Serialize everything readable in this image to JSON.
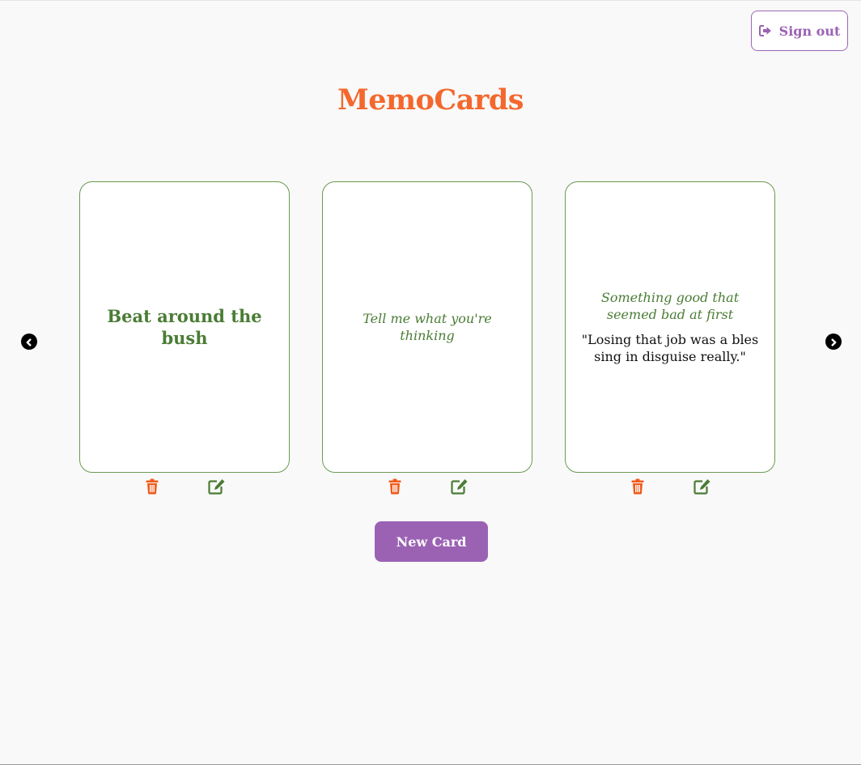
{
  "header": {
    "signout_label": "Sign out",
    "signout_icon": "sign-out-icon"
  },
  "app": {
    "title": "MemoCards"
  },
  "carousel": {
    "prev_icon": "chevron-circle-left-icon",
    "next_icon": "chevron-circle-right-icon",
    "cards": [
      {
        "front": "Beat around the bush"
      },
      {
        "meaning": "Tell me what you're thinking"
      },
      {
        "meaning": "Something good that seemed bad at first",
        "example": "\"Losing that job was a blessing in disguise really.\""
      }
    ],
    "card_actions": {
      "delete_icon": "trash-icon",
      "edit_icon": "edit-icon"
    }
  },
  "footer": {
    "new_card_label": "New Card"
  },
  "colors": {
    "background": "#f9f9f9",
    "title": "#f4682d",
    "card_text": "#4a7c35",
    "card_border": "#6a9a52",
    "accent_purple": "#9b62b4",
    "delete": "#f05a1a",
    "edit": "#4a7c35"
  }
}
